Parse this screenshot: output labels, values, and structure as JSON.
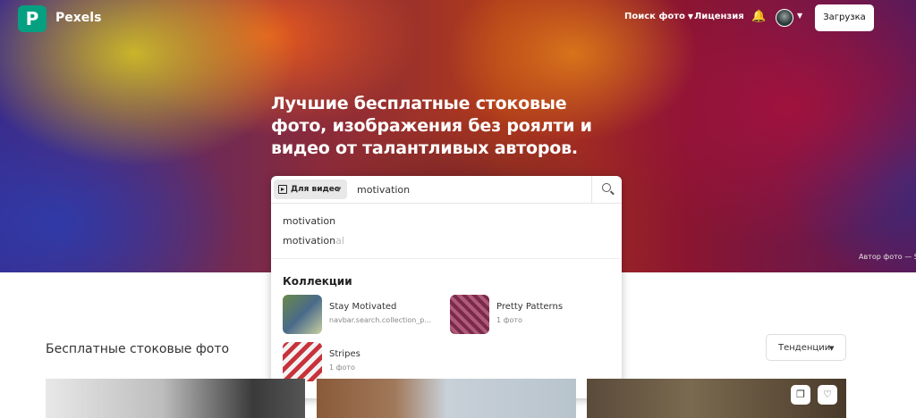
{
  "header": {
    "brand": "Pexels",
    "nav_search": "Поиск фото",
    "nav_license": "Лицензия",
    "upload": "Загрузка",
    "bell_icon": "bell-icon"
  },
  "hero": {
    "title": "Лучшие бесплатные стоковые фото, изображения без роялти и видео от талантливых авторов.",
    "credit": "Автор фото — S"
  },
  "search": {
    "type_label": "Для видео",
    "value": "motivation",
    "suggestions": [
      {
        "typed": "motivation",
        "rest": ""
      },
      {
        "typed": "motivation",
        "rest": "al"
      }
    ],
    "collections_heading": "Коллекции",
    "collections": [
      {
        "title": "Stay Motivated",
        "subtitle": "navbar.search.collection_p..."
      },
      {
        "title": "Pretty Patterns",
        "subtitle": "1 фото"
      },
      {
        "title": "Stripes",
        "subtitle": "1 фото"
      }
    ]
  },
  "main": {
    "section_title": "Бесплатные стоковые фото",
    "sort_label": "Тенденции"
  }
}
